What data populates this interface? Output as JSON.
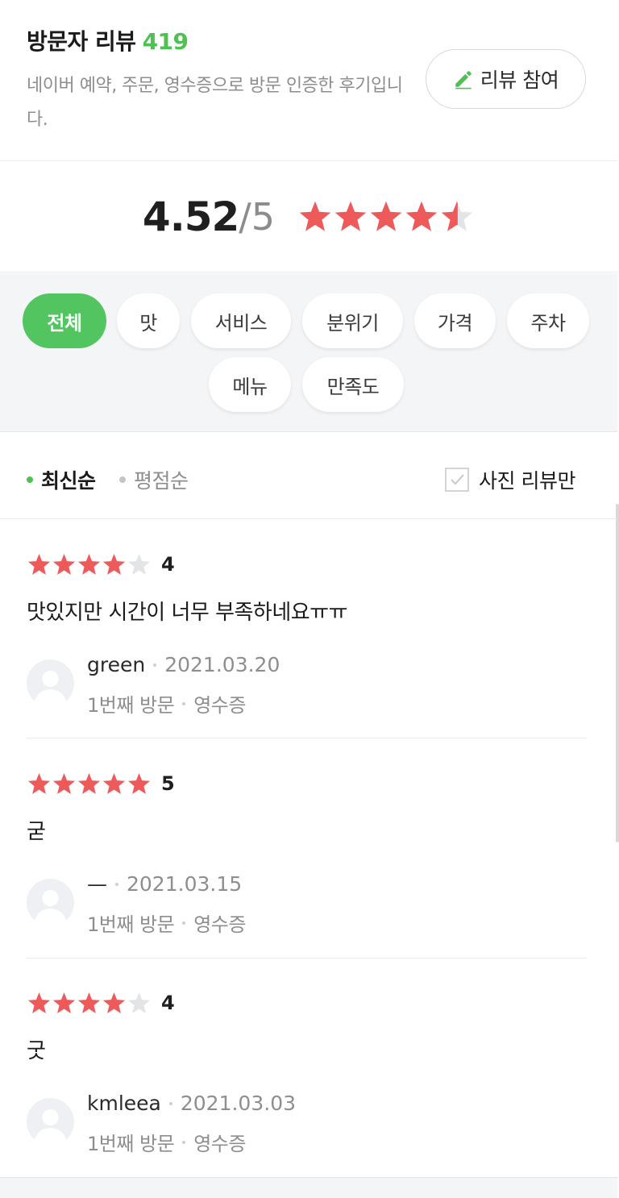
{
  "header": {
    "title": "방문자 리뷰",
    "count": "419",
    "subtitle": "네이버 예약, 주문, 영수증으로 방문 인증한 후기입니다.",
    "write_button": "리뷰 참여"
  },
  "rating": {
    "value": "4.52",
    "max": "/5",
    "stars": 4.52
  },
  "filters": {
    "chips": [
      "전체",
      "맛",
      "서비스",
      "분위기",
      "가격",
      "주차",
      "메뉴",
      "만족도"
    ],
    "active": "전체"
  },
  "sort": {
    "latest": "최신순",
    "rating": "평점순",
    "photo_only": "사진 리뷰만"
  },
  "reviews": [
    {
      "stars": 4,
      "score": "4",
      "text": "맛있지만 시간이 너무 부족하네요ㅠㅠ",
      "author": "green",
      "date": "2021.03.20",
      "visit": "1번째 방문",
      "proof": "영수증"
    },
    {
      "stars": 5,
      "score": "5",
      "text": "굳",
      "author": "—",
      "date": "2021.03.15",
      "visit": "1번째 방문",
      "proof": "영수증"
    },
    {
      "stars": 4,
      "score": "4",
      "text": "굿",
      "author": "kmleea",
      "date": "2021.03.03",
      "visit": "1번째 방문",
      "proof": "영수증"
    }
  ],
  "colors": {
    "accent": "#4dc151",
    "star": "#ee5a5a",
    "star_empty": "#e2e4e8"
  }
}
